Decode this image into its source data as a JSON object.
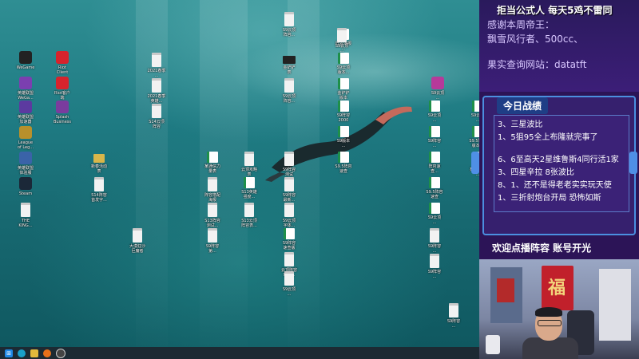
{
  "overlay": {
    "line1": "拒当公式人   每天5鸡不雷同",
    "line2": "感谢本周帝王：",
    "line3": "飘雪风行者、500cc、",
    "line4": "果实查询网站：datatft"
  },
  "record": {
    "title": "今日战绩",
    "lines": [
      "3、三星波比",
      "1、5狙95全上布隆就完事了",
      "6、6至高天2星维鲁斯4同行活1家",
      "3、四星辛拉  8张波比",
      "8、1、还不是得老老实实玩天使",
      "1、三折射炮台开局  恐怖如斯"
    ],
    "footer": "欢迎点播阵容    账号开光"
  },
  "desktop": {
    "icons": [
      {
        "label": "WeGame",
        "kind": "app",
        "color": "#222"
      },
      {
        "label": "Riot\nClient",
        "kind": "app",
        "color": "#d6232c"
      },
      {
        "label": "英雄联盟\nWeGa...",
        "kind": "app",
        "color": "#7b3fb0"
      },
      {
        "label": "Riot客户\n端",
        "kind": "app",
        "color": "#d6232c"
      },
      {
        "label": "英雄联盟\n加速器",
        "kind": "app",
        "color": "#5c3aa0"
      },
      {
        "label": "Splash\nBusiness",
        "kind": "app",
        "color": "#7a3c9e"
      },
      {
        "label": "League\nof Leg...",
        "kind": "app",
        "color": "#b8902b"
      },
      {
        "label": "英雄联盟\n体验服",
        "kind": "app",
        "color": "#3a63a8"
      },
      {
        "label": "Steam",
        "kind": "app",
        "color": "#1b2838"
      },
      {
        "label": "THE\nKING...",
        "kind": "doc",
        "color": "#ddd"
      },
      {
        "label": "2021春季\n...",
        "kind": "doc",
        "color": "#eee"
      },
      {
        "label": "2021春季\n英雄...",
        "kind": "doc",
        "color": "#eee"
      },
      {
        "label": "S14云顶\n阵容",
        "kind": "doc",
        "color": "#eee"
      },
      {
        "label": "新春活动\n表",
        "kind": "folder",
        "color": "#d9b64a"
      },
      {
        "label": "S14阵容\n首发字...",
        "kind": "doc",
        "color": "#eee"
      },
      {
        "label": "大漠狂沙\n巨魔者",
        "kind": "doc",
        "color": "#eee"
      },
      {
        "label": "某通信力\n量表",
        "kind": "sheet",
        "color": "#1e8f49"
      },
      {
        "label": "阵容搭配\n海报",
        "kind": "doc",
        "color": "#eee"
      },
      {
        "label": "S13阵容\n测试...",
        "kind": "doc",
        "color": "#eee"
      },
      {
        "label": "S9阵容\n第...",
        "kind": "doc",
        "color": "#eee"
      },
      {
        "label": "云顶攻略\n表",
        "kind": "doc",
        "color": "#eee"
      },
      {
        "label": "S13英雄\n强度...",
        "kind": "sheet",
        "color": "#1e8f49"
      },
      {
        "label": "S13云顶\n阵容表...",
        "kind": "doc",
        "color": "#eee"
      },
      {
        "label": "S9云顶\n阵容...",
        "kind": "doc",
        "color": "#eee"
      },
      {
        "label": "金铲铲\n表",
        "kind": "dark",
        "color": "#222"
      },
      {
        "label": "S9云顶\n阵容...",
        "kind": "doc",
        "color": "#eee"
      },
      {
        "label": "S9阵容\n测试",
        "kind": "doc",
        "color": "#eee"
      },
      {
        "label": "S9阵容\n最新...",
        "kind": "doc",
        "color": "#eee"
      },
      {
        "label": "S9云顶\n字体...",
        "kind": "doc",
        "color": "#eee"
      },
      {
        "label": "S9阵容\n速查版",
        "kind": "sheet",
        "color": "#1e8f49"
      },
      {
        "label": "云顶阵容\n攻略...",
        "kind": "doc",
        "color": "#eee"
      },
      {
        "label": "S9云顶\n...",
        "kind": "doc",
        "color": "#eee"
      },
      {
        "label": "阵容海报\n...",
        "kind": "sheet",
        "color": "#1e8f49"
      },
      {
        "label": "S9云顶\n版本...",
        "kind": "sheet",
        "color": "#1e8f49"
      },
      {
        "label": "金铲铲\n版本",
        "kind": "sheet",
        "color": "#1e8f49"
      },
      {
        "label": "S9阵容\n2000",
        "kind": "sheet",
        "color": "#1e8f49"
      },
      {
        "label": "S9版本\n...",
        "kind": "sheet",
        "color": "#1e8f49"
      },
      {
        "label": "S9.5阵容\n速查",
        "kind": "sheet",
        "color": "#1e8f49"
      },
      {
        "label": "S9云顶\n...",
        "kind": "sheet",
        "color": "#1e8f49"
      },
      {
        "label": "S9阵容\n...",
        "kind": "sheet",
        "color": "#1e8f49"
      },
      {
        "label": "阵容速\n查...",
        "kind": "sheet",
        "color": "#1e8f49"
      },
      {
        "label": "S9.5阵容\n速查",
        "kind": "sheet",
        "color": "#1e8f49"
      },
      {
        "label": "S9云顶\n...",
        "kind": "sheet",
        "color": "#1e8f49"
      },
      {
        "label": "S9阵容\n...",
        "kind": "doc",
        "color": "#eee"
      },
      {
        "label": "S9阵容\n...",
        "kind": "doc",
        "color": "#eee"
      },
      {
        "label": "S9云顶\n...",
        "kind": "sheet",
        "color": "#1e8f49"
      },
      {
        "label": "S9.5阵容\n版本...",
        "kind": "sheet",
        "color": "#1e8f49"
      },
      {
        "label": "某一阵容\n...",
        "kind": "doc",
        "color": "#eee"
      },
      {
        "label": "S9云顶\n...",
        "kind": "app",
        "color": "#b63a9a"
      },
      {
        "label": "S9阵容\n...",
        "kind": "doc",
        "color": "#eee"
      },
      {
        "label": "S9云顶\n...",
        "kind": "doc",
        "color": "#eee"
      }
    ]
  },
  "taskbar": {
    "icons": [
      "start-icon",
      "edge-icon",
      "folder-icon",
      "firefox-icon",
      "obs-icon"
    ]
  },
  "colors": {
    "overlay_bg": "#2c1457",
    "record_border": "#4b8fe0",
    "sheet_green": "#1e8f49"
  }
}
